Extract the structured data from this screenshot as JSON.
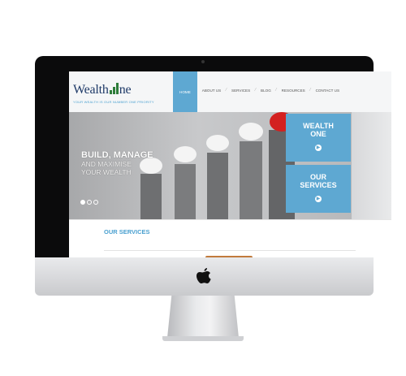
{
  "site": {
    "logo_text": "Wealth",
    "logo_text_suffix": "ne",
    "tagline": "YOUR WEALTH IS OUR NUMBER ONE PRIORITY",
    "nav": [
      {
        "label": "HOME",
        "active": true
      },
      {
        "label": "ABOUT US",
        "active": false
      },
      {
        "label": "SERVICES",
        "active": false
      },
      {
        "label": "BLOG",
        "active": false
      },
      {
        "label": "RESOURCES",
        "active": false
      },
      {
        "label": "CONTACT US",
        "active": false
      }
    ],
    "hero": {
      "line1": "BUILD, MANAGE",
      "line2": "AND MAXIMISE",
      "line3": "YOUR WEALTH"
    },
    "panels": [
      {
        "label_l1": "WEALTH",
        "label_l2": "ONE"
      },
      {
        "label_l1": "OUR",
        "label_l2": "SERVICES"
      }
    ],
    "section_title": "OUR SERVICES",
    "colors": {
      "accent": "#5ea8d2",
      "logo": "#1f3a68",
      "piggy_red": "#d32020"
    }
  }
}
